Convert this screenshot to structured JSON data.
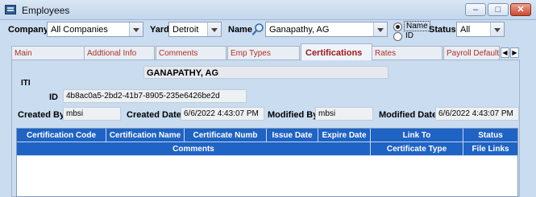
{
  "window": {
    "title": "Employees"
  },
  "filters": {
    "company_label": "Company",
    "company_value": "All Companies",
    "yard_label": "Yard",
    "yard_value": "Detroit",
    "name_label": "Name",
    "name_value": "Ganapathy, AG",
    "radio_name": "Name",
    "radio_id": "ID",
    "status_label": "Status",
    "status_value": "All"
  },
  "tabs": [
    "Main",
    "Addtional Info",
    "Comments",
    "Emp Types",
    "Certifications",
    "Rates",
    "Payroll Defaults"
  ],
  "active_tab": "Certifications",
  "employee": {
    "display_name": "GANAPATHY, AG",
    "group_label": "ITI",
    "id_label": "ID",
    "id_value": "4b8ac0a5-2bd2-41b7-8905-235e6426be2d",
    "created_by_label": "Created By",
    "created_by_value": "mbsi",
    "created_date_label": "Created Date",
    "created_date_value": "6/6/2022 4:43:07 PM",
    "modified_by_label": "Modified By",
    "modified_by_value": "mbsi",
    "modified_date_label": "Modified Date",
    "modified_date_value": "6/6/2022 4:43:07 PM"
  },
  "grid": {
    "headers_row1": [
      "Certification Code",
      "Certification Name",
      "Certificate Numb",
      "Issue Date",
      "Expire Date",
      "Link To",
      "Status"
    ],
    "headers_row2": [
      "Comments",
      "Certificate Type",
      "File Links"
    ]
  }
}
